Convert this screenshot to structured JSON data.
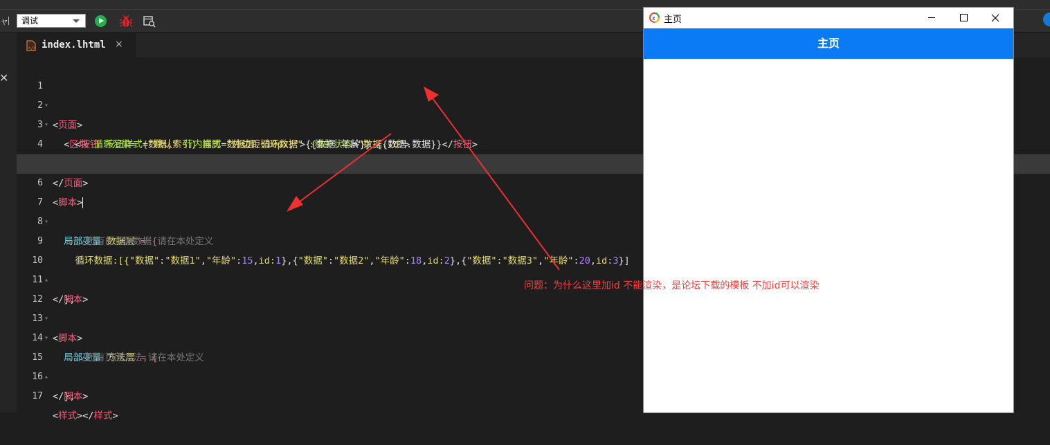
{
  "toolbar": {
    "edge_text": "ャ",
    "mode_select": "调试"
  },
  "tab": {
    "label": "index.lhtml",
    "close": "×"
  },
  "editor": {
    "lines": [
      {
        "n": "1",
        "fold": "▾"
      },
      {
        "n": "2",
        "fold": "▾"
      },
      {
        "n": "3",
        "fold": ""
      },
      {
        "n": "4",
        "fold": ""
      },
      {
        "n": "5",
        "fold": ""
      },
      {
        "n": "6",
        "fold": ""
      },
      {
        "n": "7",
        "fold": "▾"
      },
      {
        "n": "8",
        "fold": ""
      },
      {
        "n": "9",
        "fold": ""
      },
      {
        "n": "10",
        "fold": "▴"
      },
      {
        "n": "11",
        "fold": ""
      },
      {
        "n": "12",
        "fold": "▾"
      },
      {
        "n": "13",
        "fold": "▾"
      },
      {
        "n": "14",
        "fold": ""
      },
      {
        "n": "15",
        "fold": "▴"
      },
      {
        "n": "16",
        "fold": ""
      },
      {
        "n": "17",
        "fold": ""
      }
    ],
    "t": {
      "page": "页面",
      "block": "区块",
      "loop_attr": "循环渲染",
      "loop_val": "\"(数据,索引) 遍历 数据层.循环数据\"",
      "keep_attr": ":维护状态",
      "keep_val": "\"数据.id\"",
      "button": "按钮",
      "btn_style_attr": "按钮样式",
      "btn_style_val": "\"默认\"",
      "inline_attr": "行内样式",
      "inline_val": "\"外边距:10px;\"",
      "mustache": "{{数据.年龄}} {{数据.数据}}",
      "script": "脚本",
      "local_var": "局部变量",
      "data_layer": "数据层",
      "method_layer": "方法层",
      "assign": "= {",
      "comment_data": "//所有的页面数据,请在本处定义",
      "comment_methods": "//所有页面方法,请在本处定义",
      "loop_key": "循环数据:[{",
      "k_data": "\"数据\"",
      "v_data1": "\"数据1\"",
      "v_data2": "\"数据2\"",
      "v_data3": "\"数据3\"",
      "k_age": "\"年龄\"",
      "age1": "15",
      "age2": "18",
      "age3": "20",
      "id_key": "id:",
      "id1": "1",
      "id2": "2",
      "id3": "3",
      "close_brace": "};",
      "style": "样式"
    }
  },
  "annotation": "问题：为什么这里加id 不能渲染，是论坛下载的模板 不加id可以渲染",
  "preview": {
    "window_title": "主页",
    "header_title": "主页"
  }
}
